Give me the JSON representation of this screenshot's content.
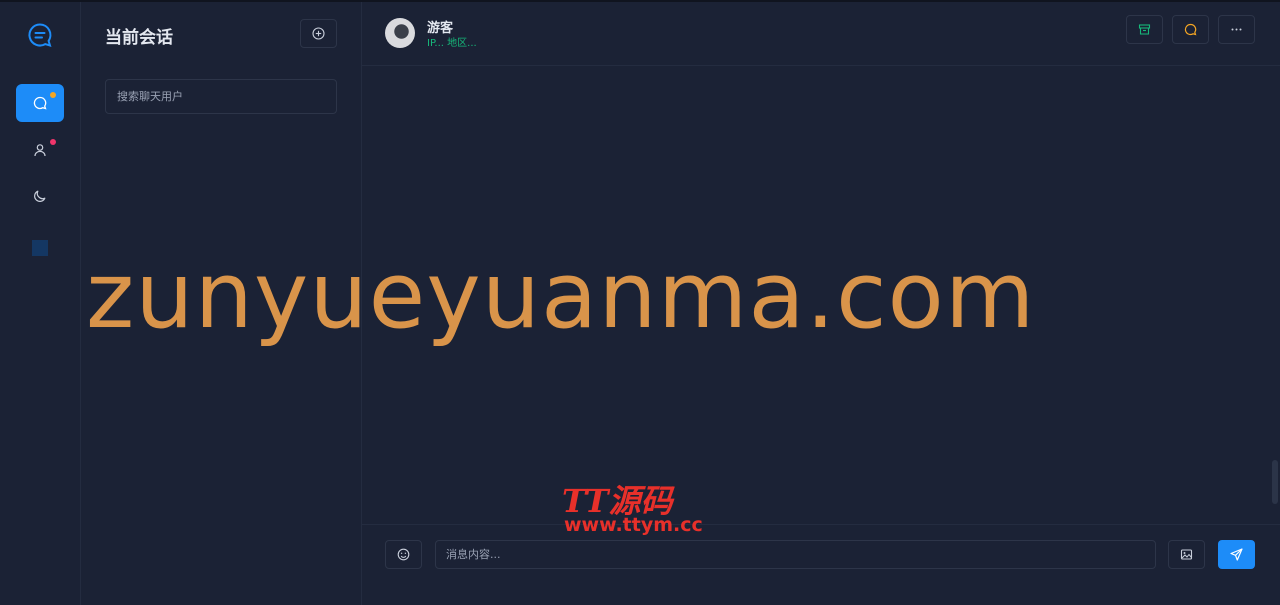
{
  "sidebar": {
    "nav": [
      {
        "icon": "chat-icon",
        "active": true,
        "badge_color": "#f5a623"
      },
      {
        "icon": "user-icon",
        "active": false,
        "badge_color": "#f0356b"
      },
      {
        "icon": "moon-icon",
        "active": false
      }
    ],
    "accent": "#1d8cf8"
  },
  "conversations": {
    "title": "当前会话",
    "add_icon": "plus-circle-icon",
    "search_placeholder": "搜索聊天用户"
  },
  "chat": {
    "user_name": "游客",
    "user_meta": "IP... 地区...",
    "user_meta_color": "#16b97a",
    "header_actions": [
      {
        "icon": "archive-icon",
        "color": "#16b97a"
      },
      {
        "icon": "comment-icon",
        "color": "#f5a623"
      },
      {
        "icon": "more-icon",
        "color": "#c9cfdb"
      }
    ],
    "composer": {
      "emoji_icon": "smile-icon",
      "placeholder": "消息内容...",
      "image_icon": "image-icon",
      "send_icon": "send-icon"
    }
  },
  "watermarks": {
    "main": "zunyueyuanma.com",
    "brand": "TT源码",
    "url": "www.ttym.cc"
  }
}
